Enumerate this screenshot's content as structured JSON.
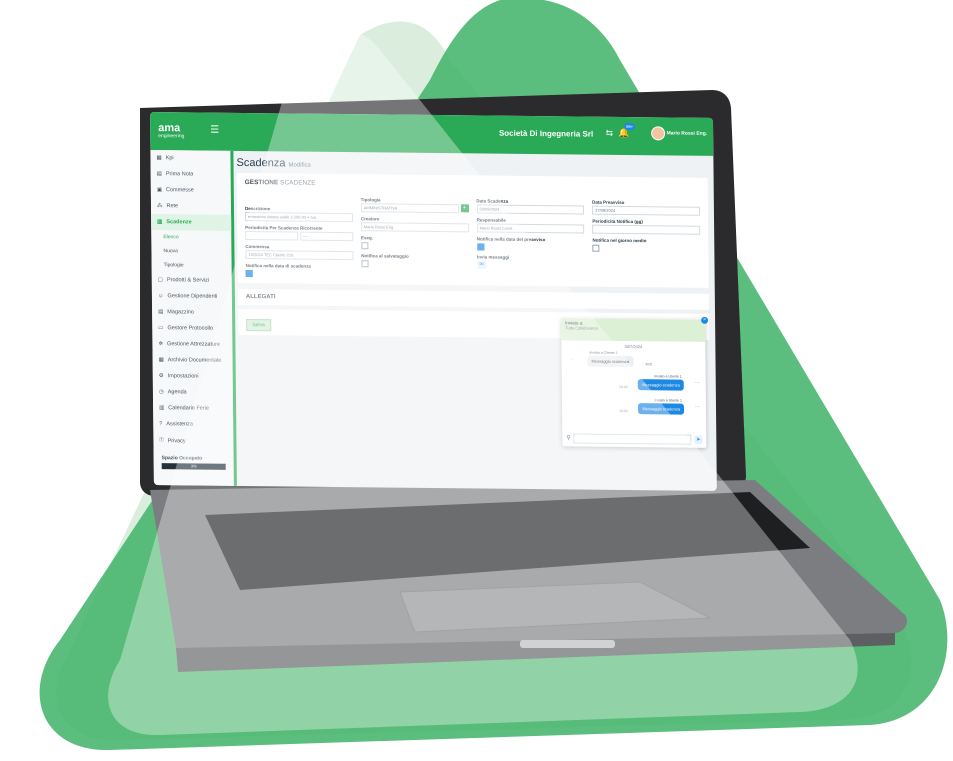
{
  "brand_colors": {
    "green": "#2aa956",
    "dark_green": "#3c9c55",
    "blue": "#1e88e5"
  },
  "app": {
    "logo_name": "ama",
    "logo_sub": "engineering",
    "company": "Società Di Ingegneria Srl",
    "badge": "99+",
    "user": "Mario Rossi Eng."
  },
  "sidebar": {
    "items": [
      {
        "label": "Kpi",
        "icon": "chart-icon"
      },
      {
        "label": "Prima Nota",
        "icon": "note-icon"
      },
      {
        "label": "Commesse",
        "icon": "folder-icon"
      },
      {
        "label": "Rete",
        "icon": "network-icon"
      },
      {
        "label": "Scadenze",
        "icon": "calendar-icon"
      }
    ],
    "sub_items": [
      "Elenco",
      "Nuova",
      "Tipologie"
    ],
    "items2": [
      {
        "label": "Prodotti & Servizi",
        "icon": "box-icon"
      },
      {
        "label": "Gestione Dipendenti",
        "icon": "people-icon"
      },
      {
        "label": "Magazzino",
        "icon": "warehouse-icon"
      },
      {
        "label": "Gestore Protocollo",
        "icon": "file-icon"
      },
      {
        "label": "Gestione Attrezzature",
        "icon": "tools-icon"
      },
      {
        "label": "Archivio Documentale",
        "icon": "archive-icon"
      },
      {
        "label": "Impostazioni",
        "icon": "gear-icon"
      },
      {
        "label": "Agenda",
        "icon": "agenda-icon"
      },
      {
        "label": "Calendario Ferie",
        "icon": "calendar-icon"
      },
      {
        "label": "Assistenza",
        "icon": "help-icon"
      },
      {
        "label": "Privacy",
        "icon": "lock-icon"
      }
    ],
    "space_label": "Spazio Occupato",
    "space_value": "3%"
  },
  "page": {
    "title": "Scadenza",
    "title_sub": "Modifica",
    "section_title_1": "GESTIONE",
    "section_title_2": "SCADENZE",
    "descrizione_label": "Descrizione",
    "descrizione_value": "emissione fattura saldo 3.200,00 + Iva",
    "periodicita_label": "Periodicità Per Scadenza Ricorrente",
    "periodicita_select": "---",
    "commessa_label": "Commessa",
    "commessa_value": "15/2024 TEC Cliente 216",
    "notifica_scadenza_label": "Notifica nella data di scadenza",
    "tipologia_label": "Tipologia",
    "tipologia_value": "AMMINISTRATIVA",
    "creatore_label": "Creatore",
    "creatore_value": "Mario Rossi Eng.",
    "eseguita_label": "Eseg.",
    "notifica_salvataggio_label": "Notifica al salvataggio",
    "data_scadenza_label": "Data Scadenza",
    "data_scadenza_value": "30/09/2024",
    "responsabile_label": "Responsabile",
    "responsabile_value": "Mario Rossi Const",
    "notifica_preavviso_label": "Notifica nella data del preavviso",
    "invia_messaggi_label": "Invia messaggi",
    "data_preavviso_label": "Data Preavviso",
    "data_preavviso_value": "27/09/2024",
    "periodicita_notifica_label": "Periodicità Notifica (gg)",
    "notifica_giorno_label": "Notifica nel giorno medio",
    "allegati_label": "ALLEGATI",
    "save_label": "Salva"
  },
  "chat": {
    "title": "Inviato a:",
    "subtitle": "Tutte Collaboratori",
    "date": "30/7/2024",
    "messages": [
      {
        "dir": "in",
        "name": "Inviato a Cliente 1",
        "text": "Messaggio scadenza",
        "time": "9:02"
      },
      {
        "dir": "out",
        "name": "Inviato a Utente 1",
        "text": "Messaggio scadenza",
        "time": "10:02"
      },
      {
        "dir": "out",
        "name": "Inviato a Utente 1",
        "text": "Messaggio scadenza",
        "time": "10:02"
      }
    ]
  }
}
